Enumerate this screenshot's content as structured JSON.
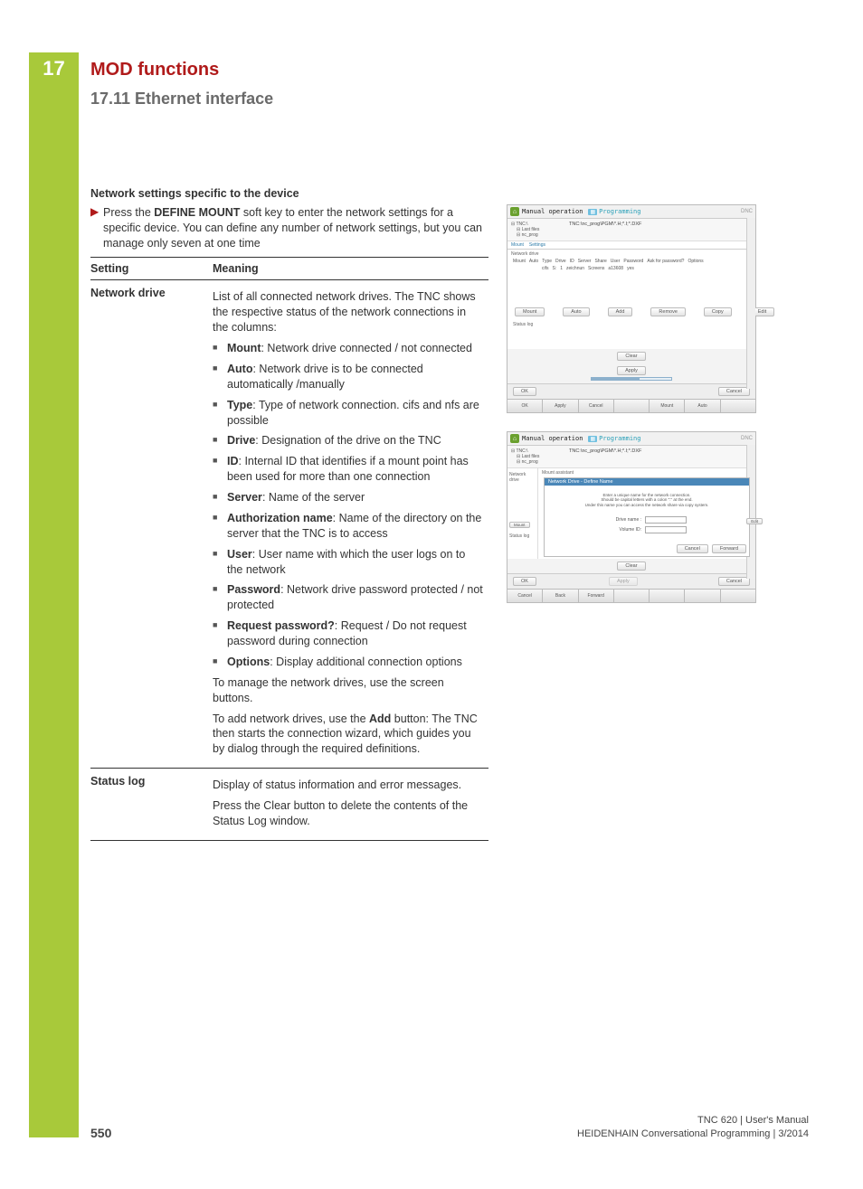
{
  "chapter_number": "17",
  "h1": "MOD functions",
  "h2": "17.11  Ethernet interface",
  "section_title": "Network settings specific to the device",
  "intro_pre": "Press the ",
  "intro_key": "DEFINE MOUNT",
  "intro_post": " soft key to enter the network settings for a specific device. You can define any number of network settings, but you can manage only seven at one time",
  "table": {
    "head_setting": "Setting",
    "head_meaning": "Meaning",
    "row_nd_label": "Network drive",
    "nd_intro": "List of all connected network drives. The TNC shows the respective status of the network connections in the columns:",
    "nd_items": [
      {
        "term": "Mount",
        "desc": ": Network drive connected / not connected"
      },
      {
        "term": "Auto",
        "desc": ": Network drive is to be connected automatically /manually"
      },
      {
        "term": "Type",
        "desc": ": Type of network connection. cifs and nfs are possible"
      },
      {
        "term": "Drive",
        "desc": ": Designation of the drive on the TNC"
      },
      {
        "term": "ID",
        "desc": ": Internal ID that identifies if a mount point has been used for more than one connection"
      },
      {
        "term": "Server",
        "desc": ": Name of the server"
      },
      {
        "term": "Authorization name",
        "desc": ": Name of the directory on the server that the TNC is to access"
      },
      {
        "term": "User",
        "desc": ": User name with which the user logs on to the network"
      },
      {
        "term": "Password",
        "desc": ": Network drive password protected / not protected"
      },
      {
        "term": "Request password?",
        "desc": ": Request / Do not request password during connection"
      },
      {
        "term": "Options",
        "desc": ": Display additional connection options"
      }
    ],
    "nd_manage": "To manage the network drives, use the screen buttons.",
    "nd_add_pre": "To add network drives, use the ",
    "nd_add_bold": "Add",
    "nd_add_post": " button: The TNC then starts the connection wizard, which guides you by dialog through the required definitions.",
    "row_sl_label": "Status log",
    "sl_p1": "Display of status information and error messages.",
    "sl_p2": "Press the Clear button to delete the contents of the Status Log window."
  },
  "shot1": {
    "mode": "Manual operation",
    "prog": "Programming",
    "dnc": "DNC",
    "tree1": "Last files",
    "tree2": "nc_prog",
    "path": "TNC:\\nc_prog\\PGM\\*.H;*.I;*.DXF",
    "tabs": [
      "Mount",
      "Settings"
    ],
    "nd_label": "Network drive",
    "cols": [
      "Mount",
      "Auto",
      "Type",
      "Drive",
      "ID",
      "Server",
      "Share",
      "User",
      "Password",
      "Ask for password?",
      "Options"
    ],
    "data_row": [
      "",
      "cifs",
      "S:",
      "1",
      "zeichnun",
      "Screens",
      "a13608",
      "yes"
    ],
    "btns": [
      "Mount",
      "Auto",
      "Add",
      "Remove",
      "Copy",
      "Edit"
    ],
    "status_log": "Status log",
    "clear": "Clear",
    "apply": "Apply",
    "ok": "OK",
    "cancel": "Cancel",
    "softkeys": [
      "OK",
      "Apply",
      "Cancel",
      "",
      "Mount",
      "Auto",
      ""
    ]
  },
  "shot2": {
    "mode": "Manual operation",
    "prog": "Programming",
    "dnc": "DNC",
    "tree1": "Last files",
    "tree2": "nc_prog",
    "path": "TNC:\\nc_prog\\PGM\\*.H;*.I;*.DXF",
    "assistant": "Mount assistant",
    "wiz_title": "Network Drive - Define Name",
    "wiz_hint1": "Enter a unique name for the network connection.",
    "wiz_hint2": "Should be capital letters with a colon \":\" at the end.",
    "wiz_hint3": "Under this name you can access the network share via copy system.",
    "field_drive": "Drive name :",
    "field_id": "Volume ID:",
    "mount_btn": "Mount",
    "edit_btn": "Edit",
    "status_log": "Status log",
    "clear": "Clear",
    "wiz_cancel": "Cancel",
    "wiz_fwd": "Forward",
    "ok": "OK",
    "apply": "Apply",
    "cancel2": "Cancel",
    "softkeys": [
      "Cancel",
      "Back",
      "Forward",
      "",
      "",
      "",
      ""
    ]
  },
  "footer": {
    "page": "550",
    "line1": "TNC 620 | User's Manual",
    "line2": "HEIDENHAIN Conversational Programming | 3/2014"
  }
}
